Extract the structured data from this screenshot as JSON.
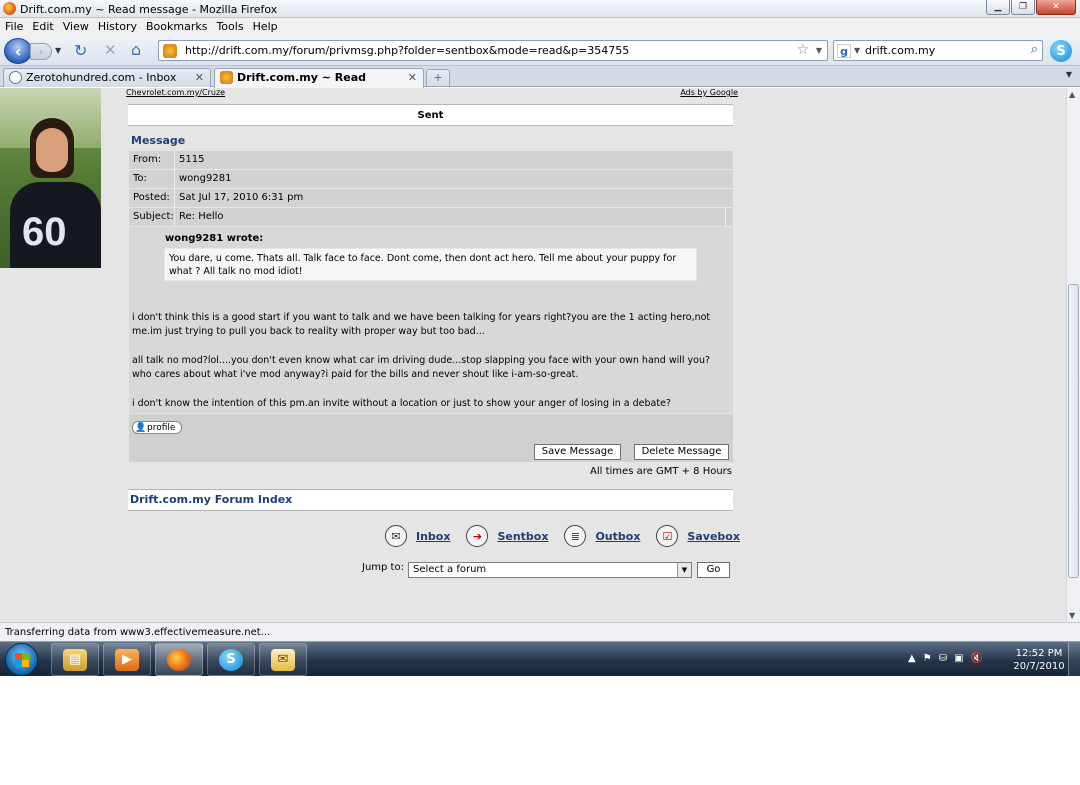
{
  "window": {
    "title": "Drift.com.my ~ Read message - Mozilla Firefox",
    "controls": [
      "minimize",
      "restore",
      "close"
    ]
  },
  "menu": [
    "File",
    "Edit",
    "View",
    "History",
    "Bookmarks",
    "Tools",
    "Help"
  ],
  "navigation": {
    "url": "http://drift.com.my/forum/privmsg.php?folder=sentbox&mode=read&p=354755",
    "search_engine_icon": "google-icon",
    "search_text": "drift.com.my"
  },
  "tabs": [
    {
      "label": "Zerotohundred.com - Inbox",
      "active": false
    },
    {
      "label": "Drift.com.my ~ Read message",
      "active": true
    }
  ],
  "ads": {
    "left_link": "Chevrolet.com.my/Cruze",
    "right_link": "Ads by Google"
  },
  "page": {
    "sent_header": "Sent",
    "message_title": "Message",
    "fields": [
      {
        "label": "From:",
        "value": "5115"
      },
      {
        "label": "To:",
        "value": "wong9281"
      },
      {
        "label": "Posted:",
        "value": "Sat Jul 17, 2010 6:31 pm"
      },
      {
        "label": "Subject:",
        "value": "Re: Hello"
      }
    ],
    "quote_author": "wong9281 wrote:",
    "quote_text": "You dare, u come. Thats all. Talk face to face. Dont come, then dont act hero. Tell me about your puppy for what ? All talk no mod idiot!",
    "body_paragraphs": [
      "i don't think this is a good start if you want to talk and we have been talking for years right?you are the 1 acting hero,not me.im just trying to pull you back to reality with proper way but too bad...",
      "all talk no mod?lol....you don't even know what car im driving dude...stop slapping you face with your own hand will you?who cares about what i've mod anyway?i paid for the bills and never shout like i-am-so-great.",
      "i don't know the intention of this pm.an invite without a location or just to show your anger of losing in a debate?"
    ],
    "profile_button": "profile",
    "save_button": "Save Message",
    "delete_button": "Delete Message",
    "timezone_note": "All times are GMT + 8 Hours",
    "forum_index": "Drift.com.my Forum Index",
    "pm_links": [
      {
        "label": "Inbox",
        "icon": "inbox-icon"
      },
      {
        "label": "Sentbox",
        "icon": "sentbox-arrow-icon"
      },
      {
        "label": "Outbox",
        "icon": "outbox-icon"
      },
      {
        "label": "Savebox",
        "icon": "savebox-check-icon"
      }
    ],
    "jump_label": "Jump to:",
    "jump_select_value": "Select a forum",
    "go_button": "Go"
  },
  "status_text": "Transferring data from www3.effectivemeasure.net...",
  "taskbar": {
    "apps": [
      "explorer-icon",
      "media-player-icon",
      "firefox-icon",
      "skype-icon",
      "messenger-icon"
    ],
    "clock_time": "12:52 PM",
    "clock_date": "20/7/2010"
  },
  "colors": {
    "link_blue": "#1f3e78",
    "page_bg": "#e5e5e5",
    "header_row_bg": "#d2d2d2"
  }
}
